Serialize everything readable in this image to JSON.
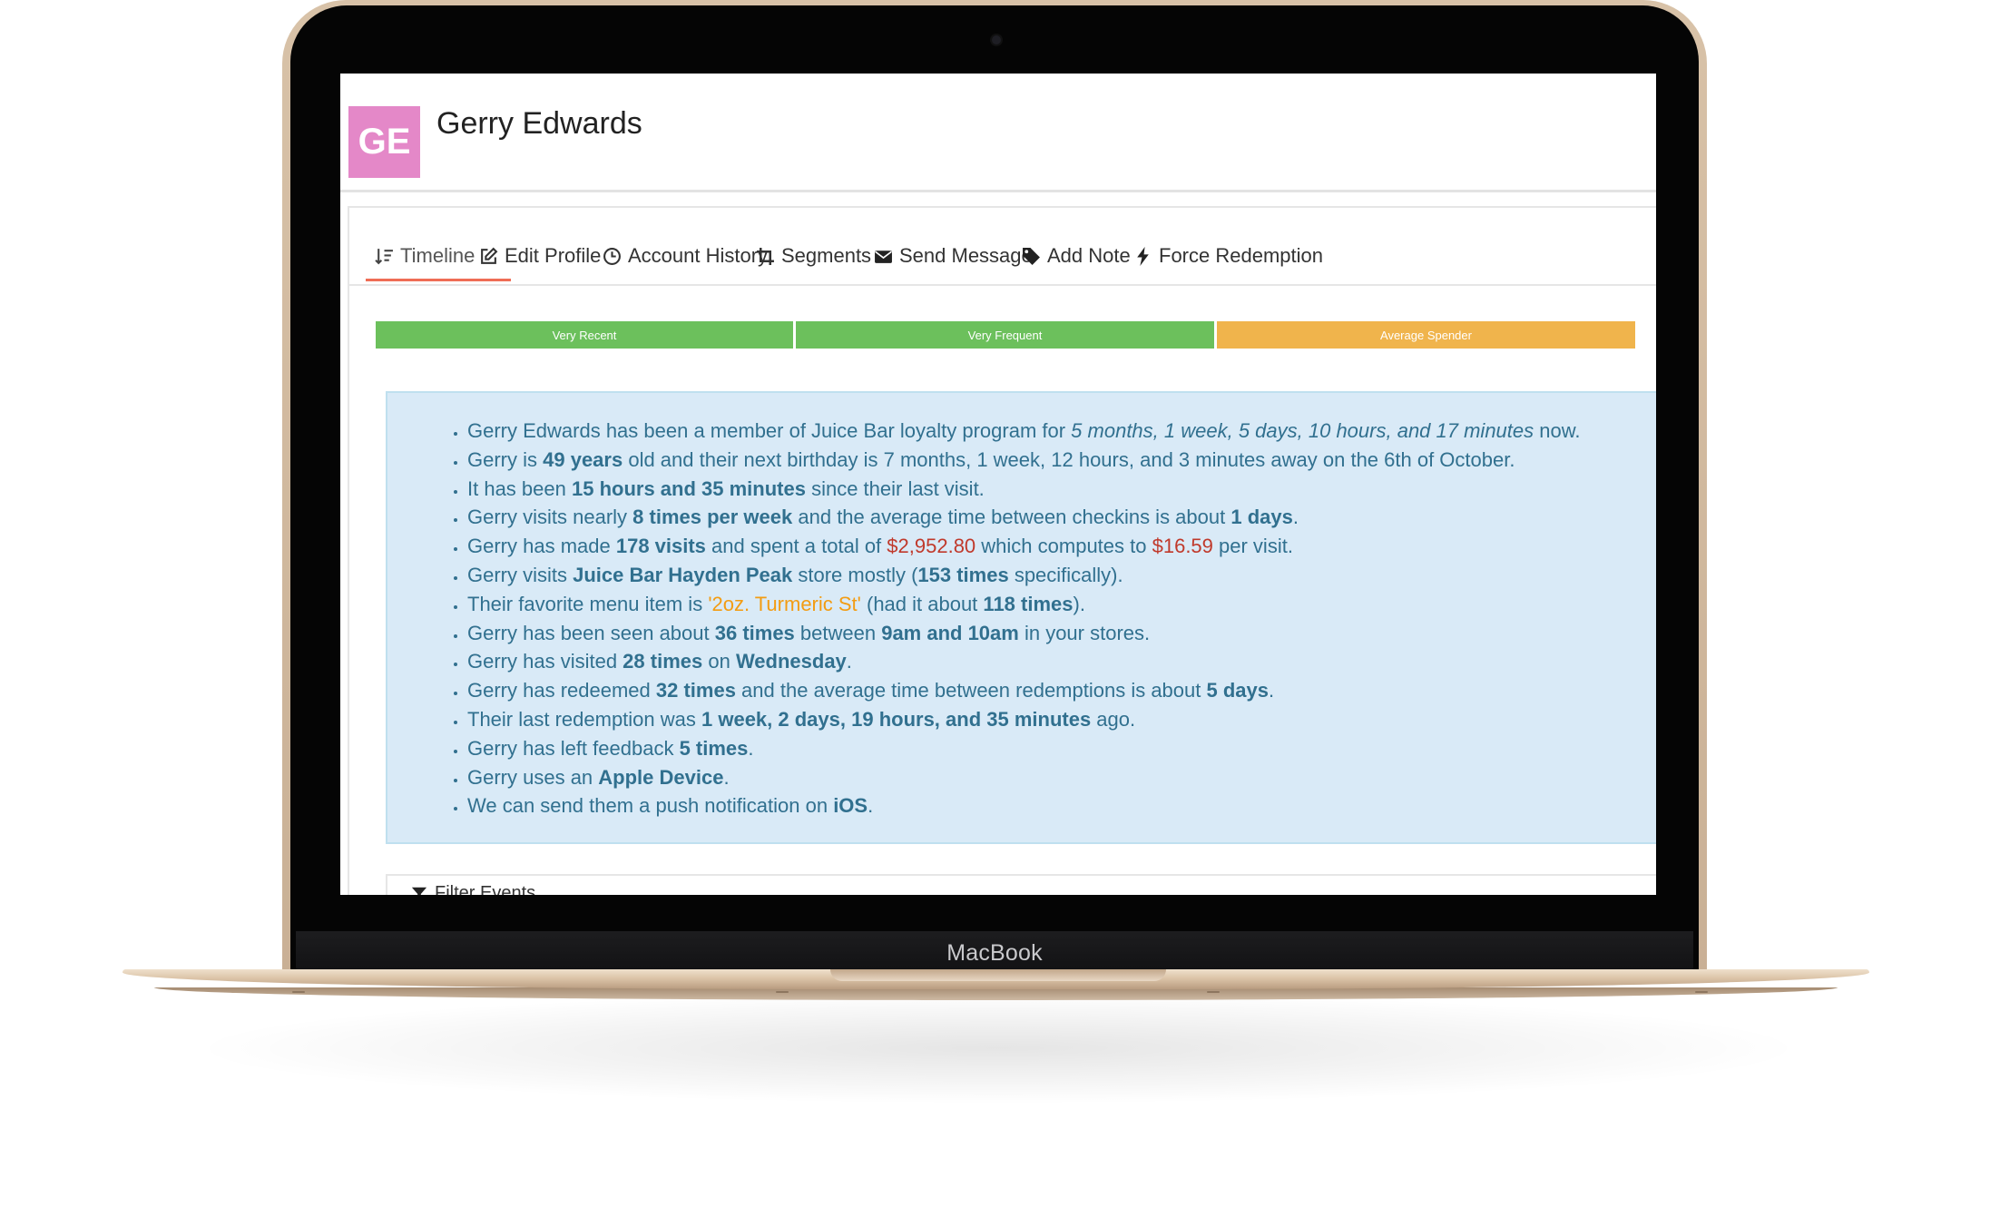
{
  "device": {
    "brand": "MacBook"
  },
  "profile": {
    "initials": "GE",
    "name": "Gerry Edwards",
    "avatar_color": "#e488c8"
  },
  "tabs": [
    {
      "label": "Timeline",
      "icon": "sort-icon",
      "active": true
    },
    {
      "label": "Edit Profile",
      "icon": "edit-icon"
    },
    {
      "label": "Account History",
      "icon": "clock-icon"
    },
    {
      "label": "Segments",
      "icon": "crop-icon"
    },
    {
      "label": "Send Message",
      "icon": "envelope-icon"
    },
    {
      "label": "Add Note",
      "icon": "tag-icon"
    },
    {
      "label": "Force Redemption",
      "icon": "bolt-icon"
    }
  ],
  "segments": [
    {
      "label": "Very Recent",
      "color": "#6cc05c"
    },
    {
      "label": "Very Frequent",
      "color": "#6cc05c"
    },
    {
      "label": "Average Spender",
      "color": "#f0b44c"
    }
  ],
  "insights": [
    [
      {
        "t": "Gerry Edwards has been a member of Juice Bar loyalty program for "
      },
      {
        "t": "5 months, 1 week, 5 days, 10 hours, and 17 minutes",
        "s": "i"
      },
      {
        "t": " now."
      }
    ],
    [
      {
        "t": "Gerry is "
      },
      {
        "t": "49 years",
        "s": "b"
      },
      {
        "t": " old and their next birthday is 7 months, 1 week, 12 hours, and 3 minutes away on the 6th of October."
      }
    ],
    [
      {
        "t": "It has been "
      },
      {
        "t": "15 hours and 35 minutes",
        "s": "b"
      },
      {
        "t": " since their last visit."
      }
    ],
    [
      {
        "t": "Gerry visits nearly "
      },
      {
        "t": "8 times per week",
        "s": "b"
      },
      {
        "t": " and the average time between checkins is about "
      },
      {
        "t": "1 days",
        "s": "b"
      },
      {
        "t": "."
      }
    ],
    [
      {
        "t": "Gerry has made "
      },
      {
        "t": "178 visits",
        "s": "b"
      },
      {
        "t": " and spent a total of "
      },
      {
        "t": "$2,952.80",
        "s": "red"
      },
      {
        "t": " which computes to "
      },
      {
        "t": "$16.59",
        "s": "red"
      },
      {
        "t": " per visit."
      }
    ],
    [
      {
        "t": "Gerry visits "
      },
      {
        "t": "Juice Bar Hayden Peak",
        "s": "b"
      },
      {
        "t": " store mostly ("
      },
      {
        "t": "153 times",
        "s": "b"
      },
      {
        "t": " specifically)."
      }
    ],
    [
      {
        "t": "Their favorite menu item is "
      },
      {
        "t": "'2oz. Turmeric St'",
        "s": "orange"
      },
      {
        "t": " (had it about "
      },
      {
        "t": "118 times",
        "s": "b"
      },
      {
        "t": ")."
      }
    ],
    [
      {
        "t": "Gerry has been seen about "
      },
      {
        "t": "36 times",
        "s": "b"
      },
      {
        "t": " between "
      },
      {
        "t": "9am and 10am",
        "s": "b"
      },
      {
        "t": " in your stores."
      }
    ],
    [
      {
        "t": "Gerry has visited "
      },
      {
        "t": "28 times",
        "s": "b"
      },
      {
        "t": " on "
      },
      {
        "t": "Wednesday",
        "s": "b"
      },
      {
        "t": "."
      }
    ],
    [
      {
        "t": "Gerry has redeemed "
      },
      {
        "t": "32 times",
        "s": "b"
      },
      {
        "t": " and the average time between redemptions is about "
      },
      {
        "t": "5 days",
        "s": "b"
      },
      {
        "t": "."
      }
    ],
    [
      {
        "t": "Their last redemption was "
      },
      {
        "t": "1 week, 2 days, 19 hours, and 35 minutes",
        "s": "b"
      },
      {
        "t": " ago."
      }
    ],
    [
      {
        "t": "Gerry has left feedback "
      },
      {
        "t": "5 times",
        "s": "b"
      },
      {
        "t": "."
      }
    ],
    [
      {
        "t": "Gerry uses an "
      },
      {
        "t": "Apple Device",
        "s": "b"
      },
      {
        "t": "."
      }
    ],
    [
      {
        "t": "We can send them a push notification on "
      },
      {
        "t": "iOS",
        "s": "b"
      },
      {
        "t": "."
      }
    ]
  ],
  "filter": {
    "label": "Filter Events",
    "icon": "filter-icon"
  },
  "colors": {
    "accent_underline": "#ef6d55",
    "info_text": "#31708f",
    "info_bg": "#d9eaf7",
    "money": "#c0392b",
    "menu_item": "#f39c12"
  }
}
